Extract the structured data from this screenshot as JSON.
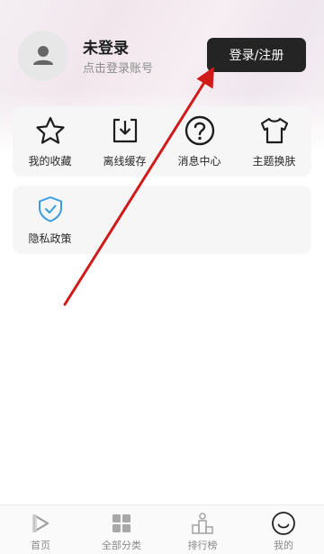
{
  "profile": {
    "name": "未登录",
    "subtitle": "点击登录账号",
    "login_button": "登录/注册"
  },
  "menu": {
    "items": [
      {
        "label": "我的收藏",
        "icon": "star-icon"
      },
      {
        "label": "离线缓存",
        "icon": "download-box-icon"
      },
      {
        "label": "消息中心",
        "icon": "question-circle-icon"
      },
      {
        "label": "主题换肤",
        "icon": "tshirt-icon"
      }
    ],
    "privacy": {
      "label": "隐私政策",
      "icon": "shield-check-icon"
    }
  },
  "tabbar": {
    "tabs": [
      {
        "label": "首页",
        "icon": "play-icon"
      },
      {
        "label": "全部分类",
        "icon": "grid-icon"
      },
      {
        "label": "排行榜",
        "icon": "podium-icon"
      },
      {
        "label": "我的",
        "icon": "smile-icon"
      }
    ]
  },
  "colors": {
    "accent_blue": "#3a9be0",
    "login_button_bg": "#242424",
    "annotation_arrow": "#d11a1a"
  }
}
